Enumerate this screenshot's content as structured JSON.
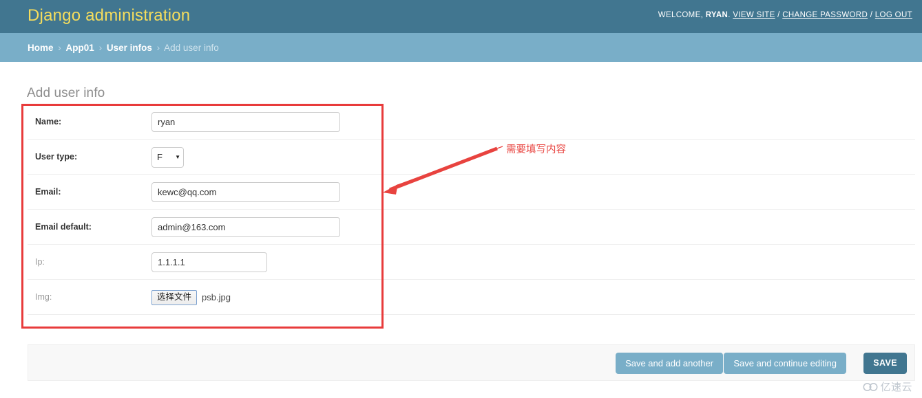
{
  "header": {
    "branding": "Django administration",
    "welcome_prefix": "WELCOME,",
    "username": "RYAN",
    "username_suffix": ".",
    "links": {
      "view_site": "VIEW SITE",
      "change_password": "CHANGE PASSWORD",
      "log_out": "LOG OUT"
    },
    "separator": "/",
    "bg_color": "#417690",
    "brand_color": "#f5dd5d"
  },
  "breadcrumbs": {
    "bg_color": "#79aec8",
    "separator": "›",
    "items": [
      {
        "label": "Home",
        "current": false
      },
      {
        "label": "App01",
        "current": false
      },
      {
        "label": "User infos",
        "current": false
      },
      {
        "label": "Add user info",
        "current": true
      }
    ]
  },
  "content": {
    "title": "Add user info"
  },
  "form": {
    "rows": [
      {
        "label": "Name:",
        "optional": false,
        "type": "text",
        "value": "ryan",
        "width": "wide"
      },
      {
        "label": "User type:",
        "optional": false,
        "type": "select",
        "value": "F",
        "caret": "▼"
      },
      {
        "label": "Email:",
        "optional": false,
        "type": "text",
        "value": "kewc@qq.com",
        "width": "wide"
      },
      {
        "label": "Email default:",
        "optional": false,
        "type": "text",
        "value": "admin@163.com",
        "width": "wide"
      },
      {
        "label": "Ip:",
        "optional": true,
        "type": "text",
        "value": "1.1.1.1",
        "width": "narrow"
      },
      {
        "label": "Img:",
        "optional": true,
        "type": "file",
        "button_label": "选择文件",
        "file_name": "psb.jpg"
      }
    ]
  },
  "annotation": {
    "text": "需要填写内容",
    "color": "#e8433f"
  },
  "submit_row": {
    "save_and_add_another": "Save and add another",
    "save_and_continue": "Save and continue editing",
    "save": "SAVE",
    "button_color": "#79aec8",
    "default_button_color": "#417690"
  },
  "watermark": {
    "text": "亿速云"
  }
}
